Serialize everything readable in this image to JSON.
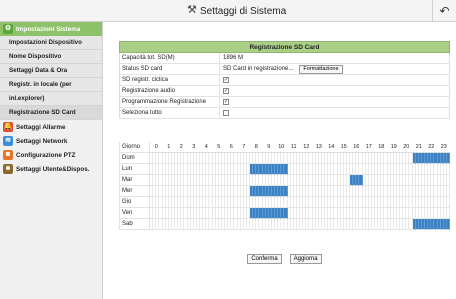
{
  "header": {
    "title": "Settaggi di Sistema",
    "tools_icon": "tools-icon",
    "back_icon": "back-arrow-icon"
  },
  "sidebar": {
    "groups": [
      {
        "label": "Impostazioni Sistema",
        "icon": "gear-icon",
        "color": "#5aa63a",
        "active": true,
        "items": [
          "Impostazioni Dispositivo",
          "Nome Dispositivo",
          "Settaggi Data & Ora",
          "Registr. in locale (per",
          "inl.explorer)",
          "Registrazione SD Card"
        ]
      },
      {
        "label": "Settaggi Allarme",
        "icon": "alarm-bell-icon",
        "color": "#e24b3b"
      },
      {
        "label": "Settaggi Network",
        "icon": "wifi-icon",
        "color": "#3a8fd6"
      },
      {
        "label": "Configurazione PTZ",
        "icon": "ptz-camera-icon",
        "color": "#e8742a"
      },
      {
        "label": "Settaggi Utente&Dispos.",
        "icon": "user-icon",
        "color": "#8a6a2c"
      }
    ]
  },
  "panel": {
    "title": "Registrazione SD Card",
    "rows": [
      {
        "label": "Capacità tot. SD(M)",
        "value": "1896 M"
      },
      {
        "label": "Status SD card",
        "value": "SD Card in registrazione...",
        "button": "Formattazione"
      },
      {
        "label": "SD registr. ciclica",
        "checked": "✓"
      },
      {
        "label": "Registrazione audio",
        "checked": "✓"
      },
      {
        "label": "Programmazione Registrazione",
        "checked": "✓"
      },
      {
        "label": "Seleziona tutto",
        "checked": ""
      }
    ]
  },
  "schedule": {
    "header_label": "Giorno",
    "hours": [
      "0",
      "1",
      "2",
      "3",
      "4",
      "5",
      "6",
      "7",
      "8",
      "9",
      "10",
      "11",
      "12",
      "13",
      "14",
      "15",
      "16",
      "17",
      "18",
      "19",
      "20",
      "21",
      "22",
      "23"
    ],
    "days": [
      {
        "name": "Dom",
        "on_hours": [
          21,
          22,
          23
        ]
      },
      {
        "name": "Lun",
        "on_hours": [
          8,
          9,
          10
        ]
      },
      {
        "name": "Mar",
        "on_hours": [
          16
        ]
      },
      {
        "name": "Mer",
        "on_hours": [
          8,
          9,
          10
        ]
      },
      {
        "name": "Gio",
        "on_hours": []
      },
      {
        "name": "Ven",
        "on_hours": [
          8,
          9,
          10
        ]
      },
      {
        "name": "Sab",
        "on_hours": [
          21,
          22,
          23
        ]
      }
    ]
  },
  "actions": {
    "confirm": "Conferma",
    "refresh": "Aggiorna"
  }
}
